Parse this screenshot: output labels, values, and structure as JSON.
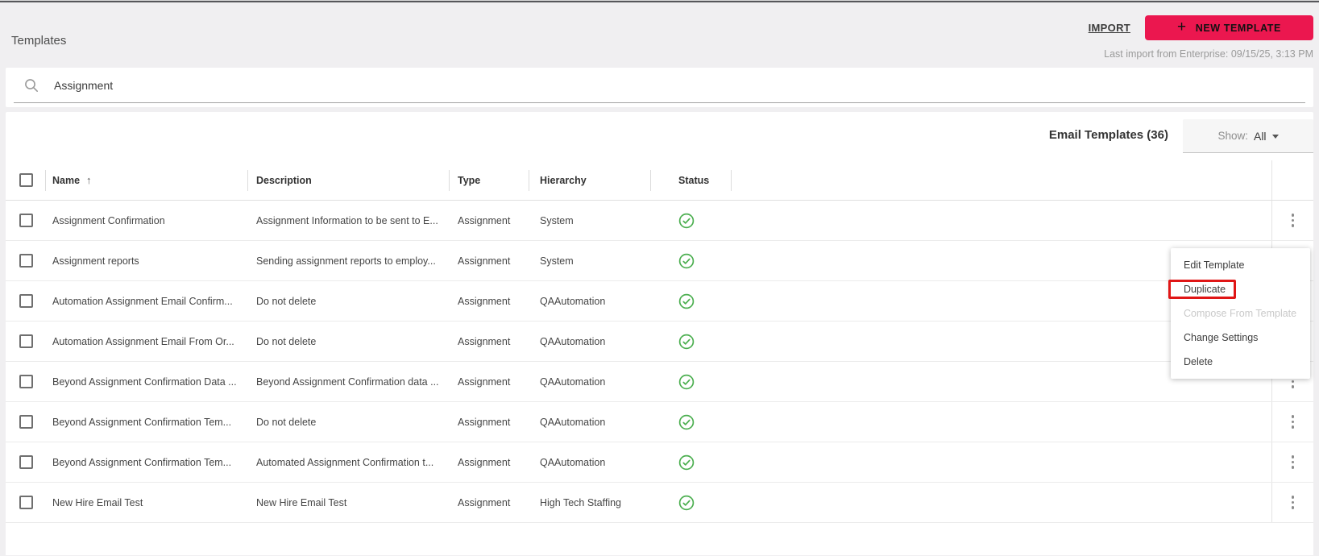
{
  "page": {
    "title": "Templates"
  },
  "header": {
    "import_label": "IMPORT",
    "new_template_label": "NEW TEMPLATE",
    "last_import": "Last import from Enterprise: 09/15/25, 3:13 PM"
  },
  "search": {
    "value": "Assignment"
  },
  "list": {
    "title": "Email Templates (36)",
    "show_label": "Show:",
    "show_value": "All"
  },
  "table": {
    "columns": [
      "Name",
      "Description",
      "Type",
      "Hierarchy",
      "Status"
    ],
    "sort_column": "Name",
    "sort_direction": "ascending",
    "rows": [
      {
        "name": "Assignment Confirmation",
        "description": "Assignment Information to be sent to E...",
        "type": "Assignment",
        "hierarchy": "System",
        "status": "active"
      },
      {
        "name": "Assignment reports",
        "description": "Sending assignment reports to employ...",
        "type": "Assignment",
        "hierarchy": "System",
        "status": "active"
      },
      {
        "name": "Automation Assignment Email Confirm...",
        "description": "Do not delete",
        "type": "Assignment",
        "hierarchy": "QAAutomation",
        "status": "active"
      },
      {
        "name": "Automation Assignment Email From Or...",
        "description": "Do not delete",
        "type": "Assignment",
        "hierarchy": "QAAutomation",
        "status": "active"
      },
      {
        "name": "Beyond Assignment Confirmation Data ...",
        "description": "Beyond Assignment Confirmation data ...",
        "type": "Assignment",
        "hierarchy": "QAAutomation",
        "status": "active"
      },
      {
        "name": "Beyond Assignment Confirmation Tem...",
        "description": "Do not delete",
        "type": "Assignment",
        "hierarchy": "QAAutomation",
        "status": "active"
      },
      {
        "name": "Beyond Assignment Confirmation Tem...",
        "description": "Automated Assignment Confirmation t...",
        "type": "Assignment",
        "hierarchy": "QAAutomation",
        "status": "active"
      },
      {
        "name": "New Hire Email Test",
        "description": "New Hire Email Test",
        "type": "Assignment",
        "hierarchy": "High Tech Staffing",
        "status": "active"
      }
    ]
  },
  "context_menu": {
    "items": [
      {
        "label": "Edit Template",
        "disabled": false,
        "highlighted": false
      },
      {
        "label": "Duplicate",
        "disabled": false,
        "highlighted": true
      },
      {
        "label": "Compose From Template",
        "disabled": true,
        "highlighted": false
      },
      {
        "label": "Change Settings",
        "disabled": false,
        "highlighted": false
      },
      {
        "label": "Delete",
        "disabled": false,
        "highlighted": false
      }
    ]
  },
  "colors": {
    "accent": "#EB174F",
    "status_active": "#4CAF50",
    "highlight_red": "#E01616"
  }
}
